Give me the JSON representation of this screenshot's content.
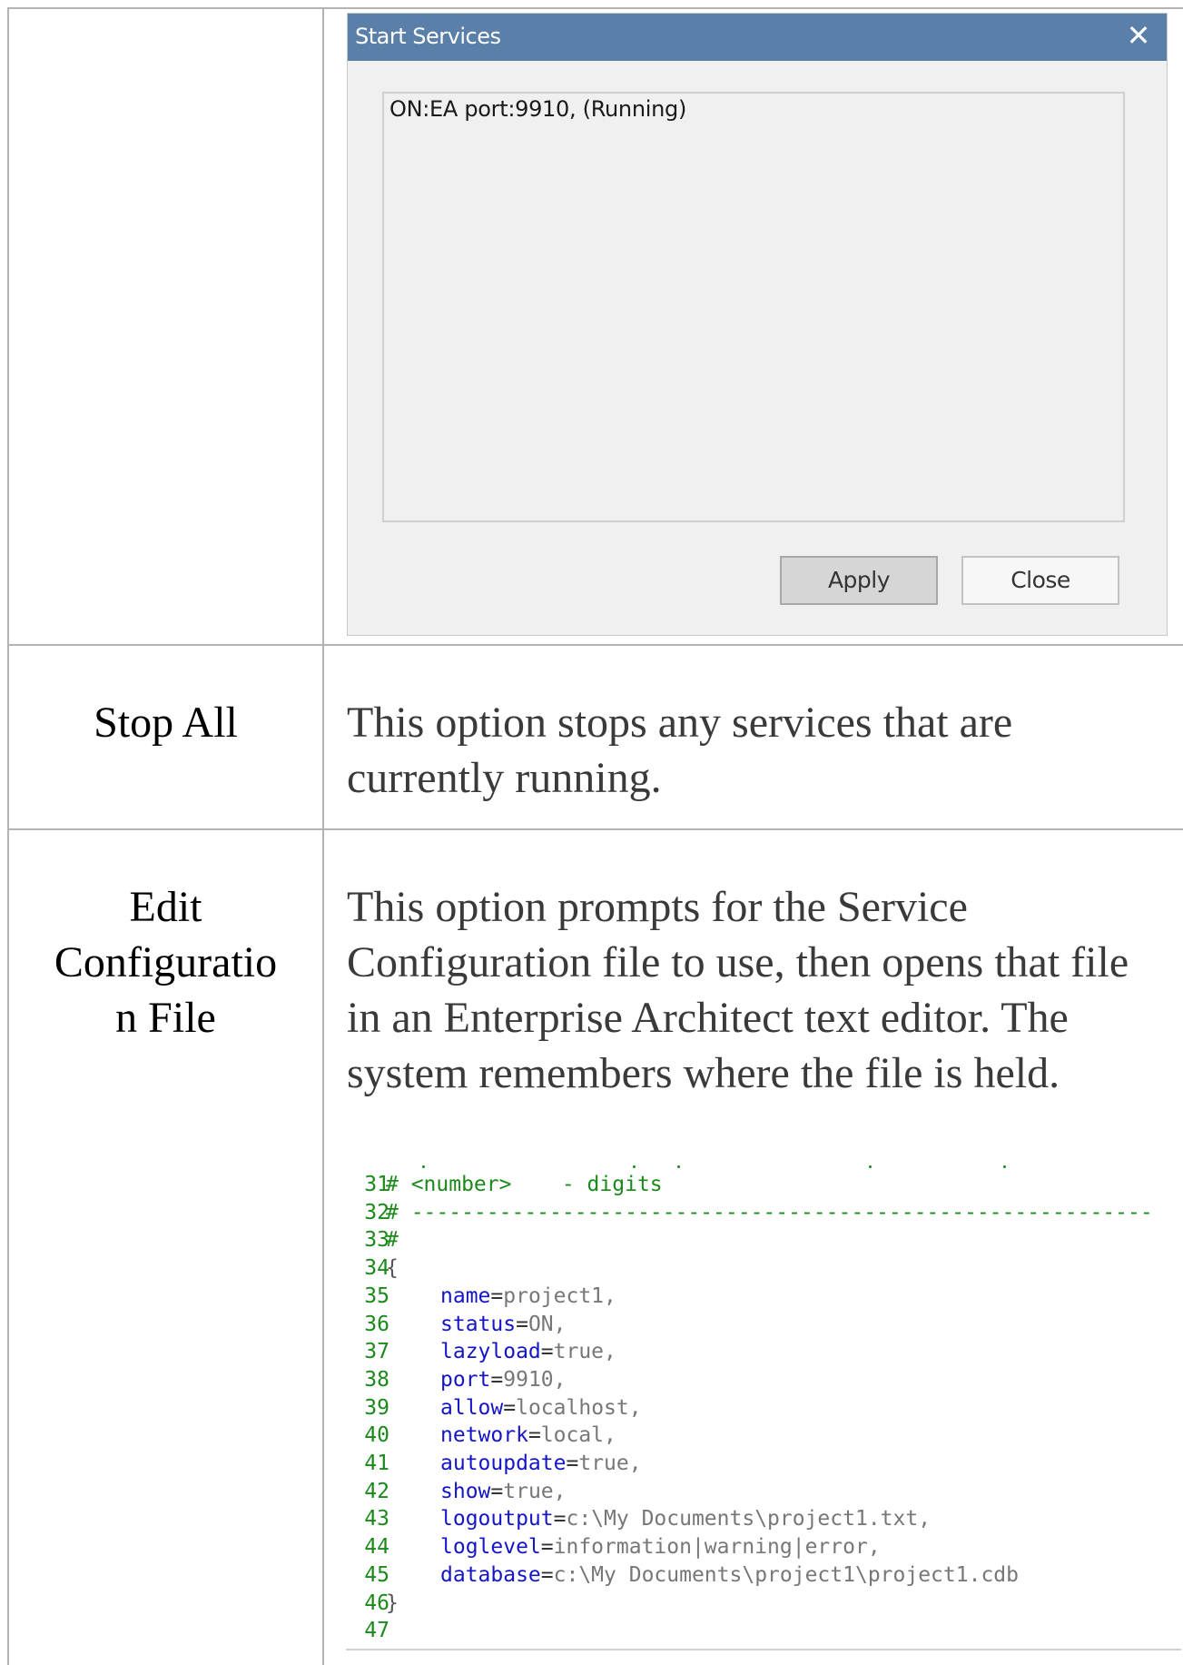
{
  "dialog": {
    "title": "Start Services",
    "close_icon": "close-x",
    "services": [
      "ON:EA port:9910, (Running)"
    ],
    "apply_label": "Apply",
    "close_label": "Close"
  },
  "rows": [
    {
      "label": "Stop All",
      "description": "This option stops any services that are currently running."
    },
    {
      "label_lines": [
        "Edit",
        "Configuratio",
        "n File"
      ],
      "description": "This option prompts for the Service Configuration file to use, then opens that file in an Enterprise Architect text editor. The system remembers where the file is held."
    }
  ],
  "code": {
    "lines": [
      {
        "n": "31",
        "comment": "# <number>    - digits"
      },
      {
        "n": "32",
        "comment": "# -----------------------------------------------------------"
      },
      {
        "n": "33",
        "comment": "#"
      },
      {
        "n": "34",
        "brace": "{"
      },
      {
        "n": "35",
        "key": "name",
        "value": "project1,"
      },
      {
        "n": "36",
        "key": "status",
        "value": "ON,"
      },
      {
        "n": "37",
        "key": "lazyload",
        "value": "true,"
      },
      {
        "n": "38",
        "key": "port",
        "value": "9910,"
      },
      {
        "n": "39",
        "key": "allow",
        "value": "localhost,"
      },
      {
        "n": "40",
        "key": "network",
        "value": "local,"
      },
      {
        "n": "41",
        "key": "autoupdate",
        "value": "true,"
      },
      {
        "n": "42",
        "key": "show",
        "value": "true,"
      },
      {
        "n": "43",
        "key": "logoutput",
        "value": "c:\\My Documents\\project1.txt,"
      },
      {
        "n": "44",
        "key": "loglevel",
        "value": "information|warning|error,"
      },
      {
        "n": "45",
        "key": "database",
        "value": "c:\\My Documents\\project1\\project1.cdb"
      },
      {
        "n": "46",
        "brace": "}"
      },
      {
        "n": "47"
      }
    ]
  }
}
